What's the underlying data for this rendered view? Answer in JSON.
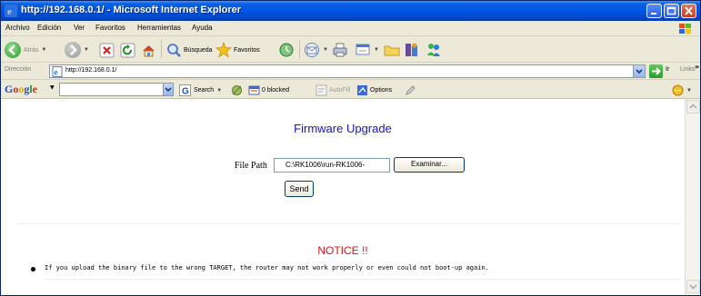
{
  "window": {
    "title": "http://192.168.0.1/ - Microsoft Internet Explorer",
    "buttons": [
      "minimize-icon",
      "maximize-icon",
      "close-icon"
    ],
    "title_bar_color": "#0055e5"
  },
  "menubar": {
    "items": [
      "Archivo",
      "Edición",
      "Ver",
      "Favoritos",
      "Herramientas",
      "Ayuda"
    ]
  },
  "toolbar": {
    "back_label": "Atrás",
    "search_label": "Búsqueda",
    "favorites_label": "Favoritos"
  },
  "addressbar": {
    "label": "Dirección",
    "url": "http://192.168.0.1/",
    "go_label": "Ir",
    "links_label": "Links",
    "more": "»"
  },
  "googlebar": {
    "logo": "Google",
    "search_value": "",
    "search_label": "Search",
    "blocked_label": "0 blocked",
    "autofill_label": "AutoFill",
    "options_label": "Options"
  },
  "page": {
    "heading": "Firmware Upgrade",
    "file_path_label": "File Path",
    "file_input_value": "C:\\RK1006\\run-RK1006-",
    "browse_label": "Examinar...",
    "send_label": "Send",
    "notice_title": "NOTICE !!",
    "notice_text": "If you upload the binary file to the wrong TARGET, the router may not work properly or even could not boot-up again.",
    "heading_color": "#1414cc",
    "notice_color": "#e01010"
  }
}
